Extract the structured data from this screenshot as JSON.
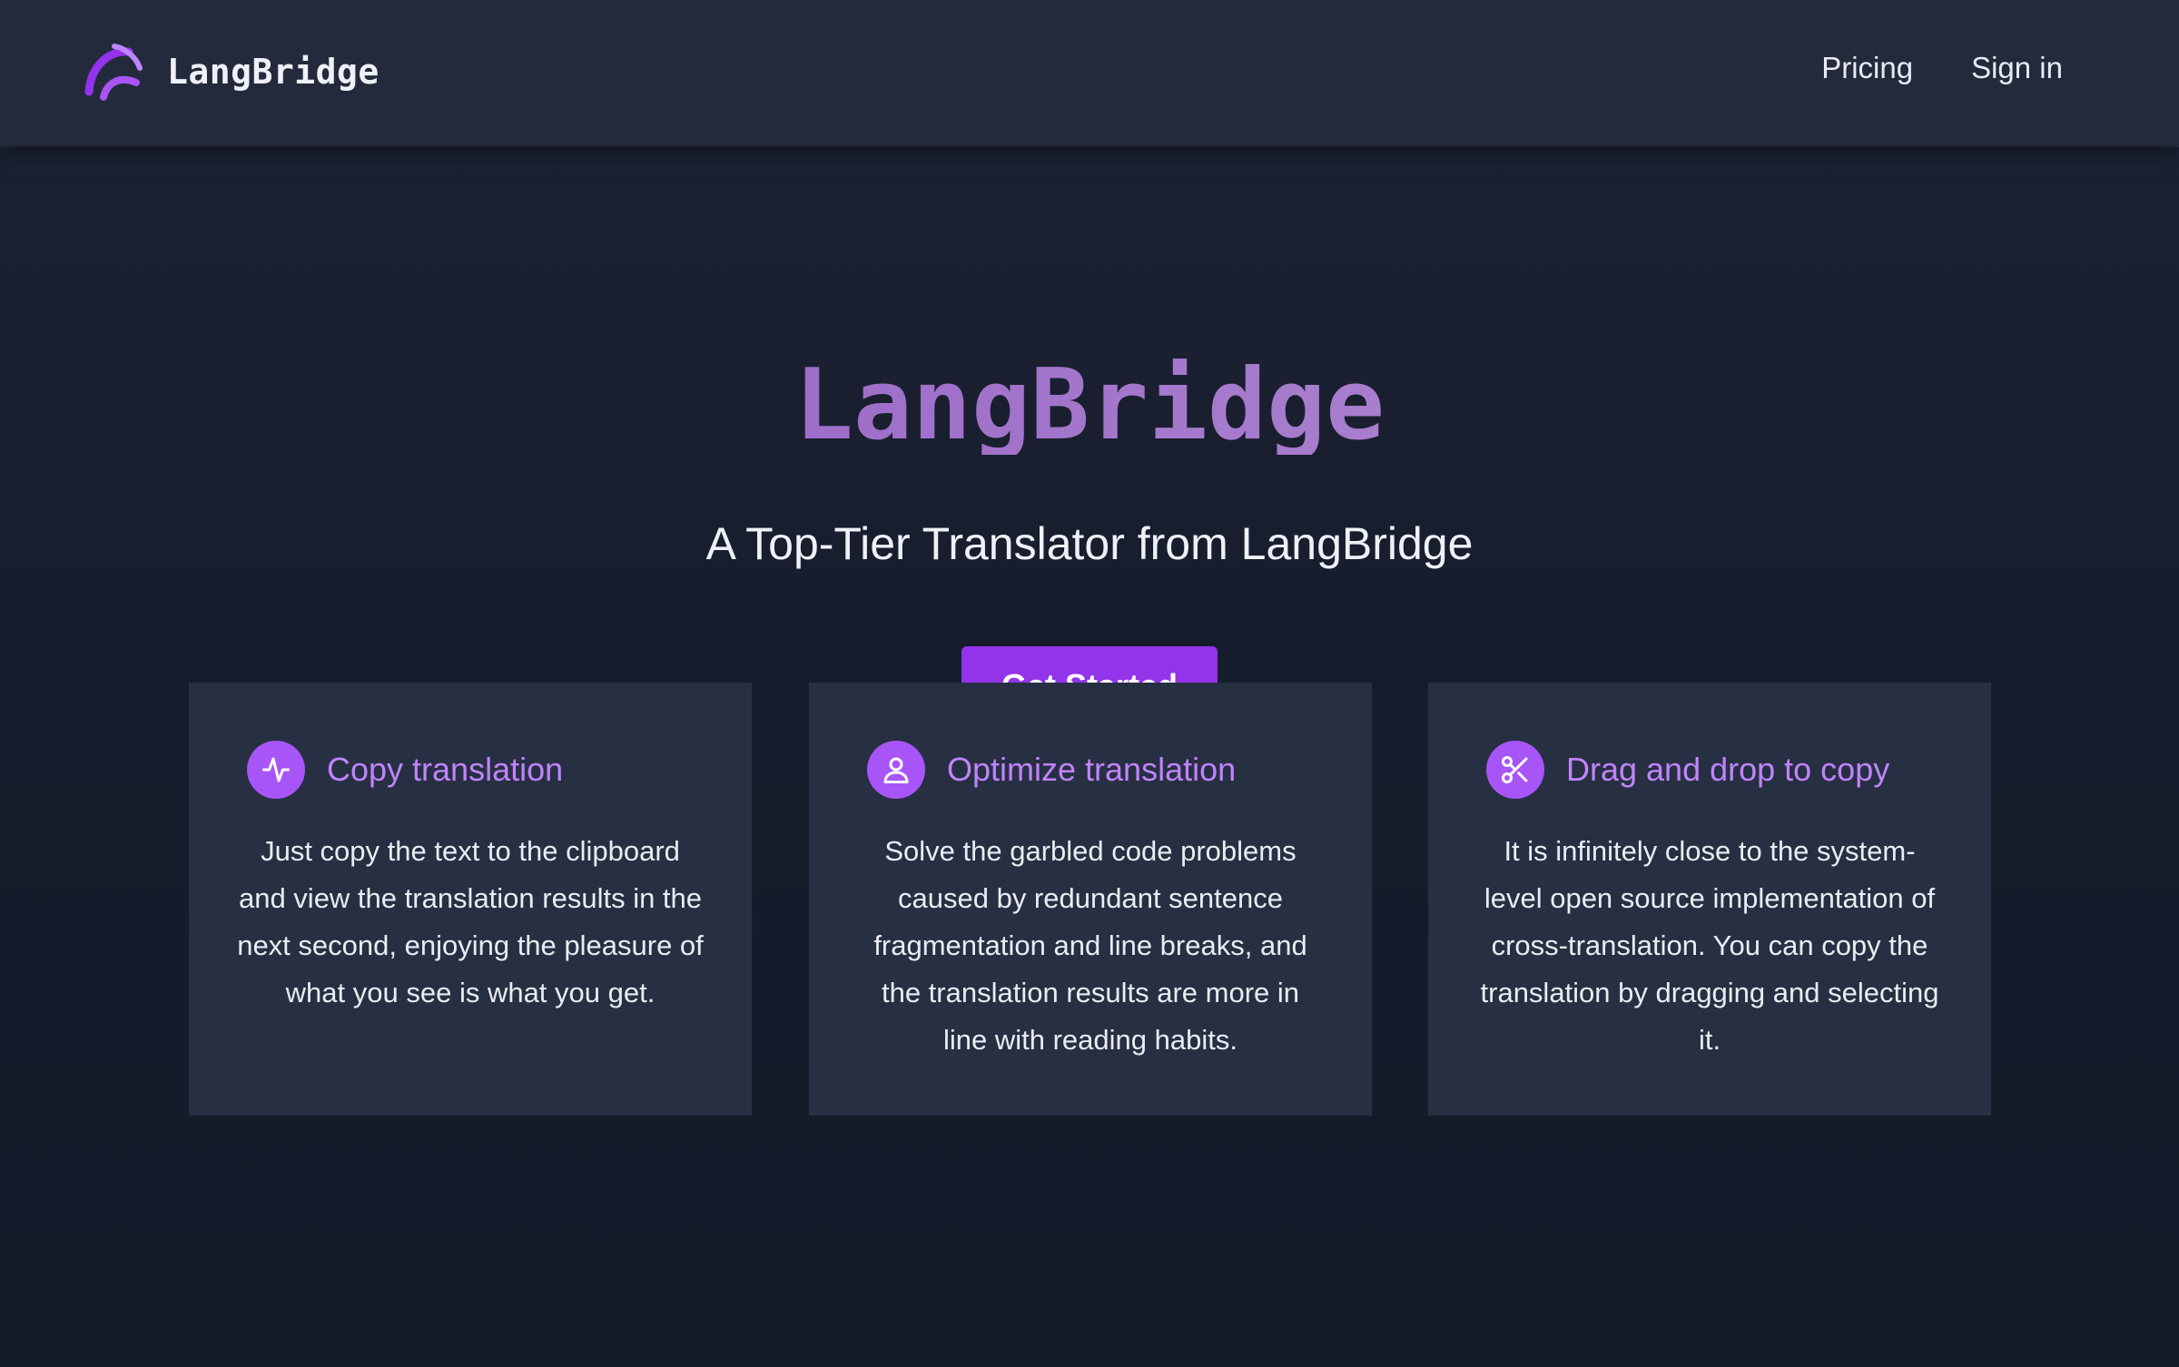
{
  "nav": {
    "brand_name": "LangBridge",
    "links": [
      "Pricing",
      "Sign in"
    ]
  },
  "hero": {
    "title": "LangBridge",
    "subtitle": "A Top-Tier Translator from LangBridge",
    "cta_label": "Get Started"
  },
  "features": [
    {
      "icon": "activity-pulse-icon",
      "title": "Copy translation",
      "text": "Just copy the text to the clipboard and view the translation results in the next second, enjoying the pleasure of what you see is what you get."
    },
    {
      "icon": "user-icon",
      "title": "Optimize translation",
      "text": "Solve the garbled code problems caused by redundant sentence fragmentation and line breaks, and the translation results are more in line with reading habits."
    },
    {
      "icon": "scissors-icon",
      "title": "Drag and drop to copy",
      "text": "It is infinitely close to the system-level open source implementation of cross-translation. You can copy the translation by dragging and selecting it."
    }
  ],
  "colors": {
    "accent": "#9333ea",
    "accent_light": "#c084fc",
    "icon_bg": "#a855f7",
    "title_gradient_start": "#8f55c2",
    "title_gradient_end": "#b08fd3",
    "nav_bg": "#232a3c",
    "page_bg": "#161d2c",
    "card_bg": "#272f42"
  }
}
